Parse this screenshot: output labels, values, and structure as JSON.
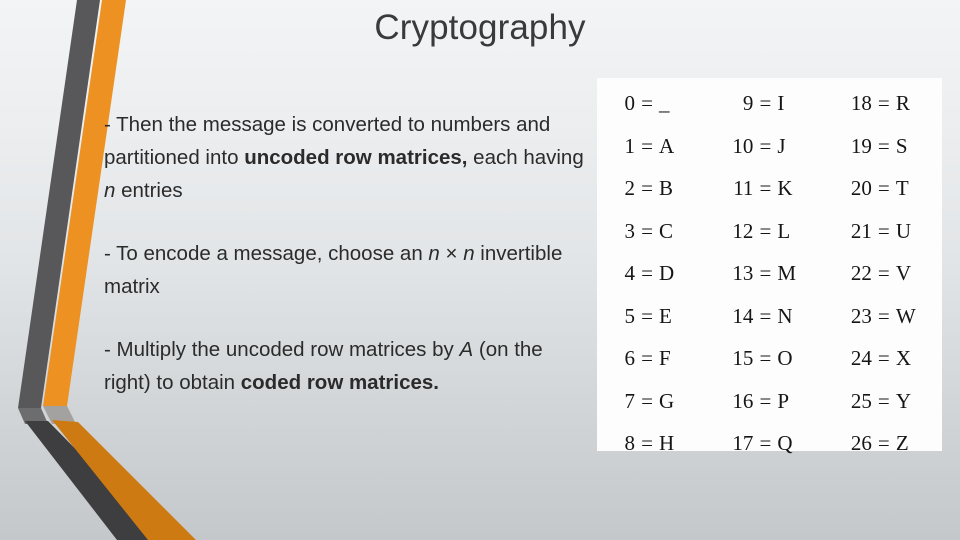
{
  "slide": {
    "title": "Cryptography",
    "background_top_color": "#f2f4f5",
    "background_bottom_color": "#c4c8ca"
  },
  "decoration": {
    "shape_name": "bent-chevron",
    "orange_color": "#ED9222",
    "orange_shade_color": "#CE7A12",
    "gray_color": "#58585A",
    "gray_shade_color": "#3E3E40"
  },
  "body": {
    "paragraphs": [
      {
        "id": "p1",
        "runs": [
          {
            "text": "- Then the message is converted to numbers and partitioned into ",
            "style": "normal"
          },
          {
            "text": "uncoded row matrices,",
            "style": "bold"
          },
          {
            "text": " each having ",
            "style": "normal"
          },
          {
            "text": "n",
            "style": "italic"
          },
          {
            "text": " entries",
            "style": "normal"
          }
        ]
      },
      {
        "id": "p2",
        "runs": [
          {
            "text": "- To encode a message, choose an ",
            "style": "normal"
          },
          {
            "text": "n",
            "style": "italic"
          },
          {
            "text": " × ",
            "style": "normal"
          },
          {
            "text": "n",
            "style": "italic"
          },
          {
            "text": " invertible matrix",
            "style": "normal"
          }
        ]
      },
      {
        "id": "p3",
        "runs": [
          {
            "text": "- Multiply the uncoded row matrices by ",
            "style": "normal"
          },
          {
            "text": "A",
            "style": "italic"
          },
          {
            "text": " (on the right) to obtain ",
            "style": "normal"
          },
          {
            "text": "coded row matrices.",
            "style": "bold"
          }
        ]
      }
    ]
  },
  "conversion_table": {
    "name": "number-to-letter-conversion-table",
    "equals_sign": "=",
    "columns": [
      {
        "rows": [
          {
            "number": "0",
            "letter": "_"
          },
          {
            "number": "1",
            "letter": "A"
          },
          {
            "number": "2",
            "letter": "B"
          },
          {
            "number": "3",
            "letter": "C"
          },
          {
            "number": "4",
            "letter": "D"
          },
          {
            "number": "5",
            "letter": "E"
          },
          {
            "number": "6",
            "letter": "F"
          },
          {
            "number": "7",
            "letter": "G"
          },
          {
            "number": "8",
            "letter": "H"
          }
        ]
      },
      {
        "rows": [
          {
            "number": "9",
            "letter": "I"
          },
          {
            "number": "10",
            "letter": "J"
          },
          {
            "number": "11",
            "letter": "K"
          },
          {
            "number": "12",
            "letter": "L"
          },
          {
            "number": "13",
            "letter": "M"
          },
          {
            "number": "14",
            "letter": "N"
          },
          {
            "number": "15",
            "letter": "O"
          },
          {
            "number": "16",
            "letter": "P"
          },
          {
            "number": "17",
            "letter": "Q"
          }
        ]
      },
      {
        "rows": [
          {
            "number": "18",
            "letter": "R"
          },
          {
            "number": "19",
            "letter": "S"
          },
          {
            "number": "20",
            "letter": "T"
          },
          {
            "number": "21",
            "letter": "U"
          },
          {
            "number": "22",
            "letter": "V"
          },
          {
            "number": "23",
            "letter": "W"
          },
          {
            "number": "24",
            "letter": "X"
          },
          {
            "number": "25",
            "letter": "Y"
          },
          {
            "number": "26",
            "letter": "Z"
          }
        ]
      }
    ]
  }
}
